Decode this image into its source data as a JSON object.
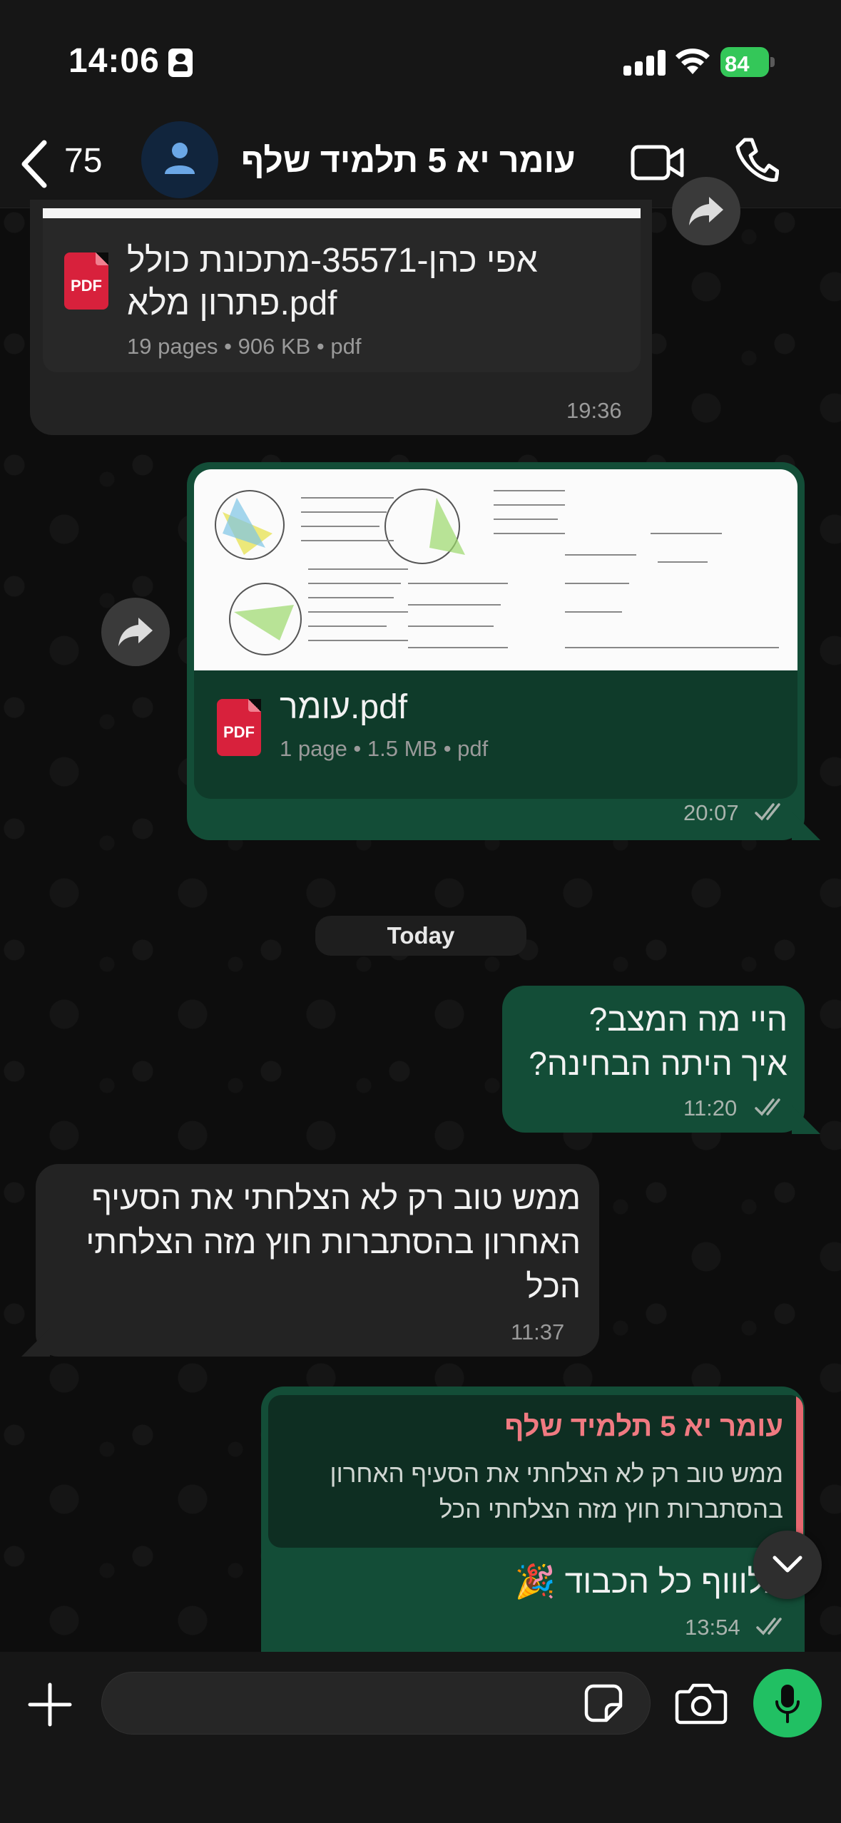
{
  "status_bar": {
    "time": "14:06",
    "battery": "84"
  },
  "header": {
    "back_count": "75",
    "chat_name": "עומר יא 5 תלמיד שלף"
  },
  "messages": [
    {
      "type": "document",
      "direction": "in",
      "file_name_line1": "אפי כהן-35571-מתכונת כולל",
      "file_name_line2": "פתרון מלא.pdf",
      "meta": "19 pages • 906 KB • pdf",
      "time": "19:36"
    },
    {
      "type": "document",
      "direction": "out",
      "file_name": "עומר.pdf",
      "meta": "1 page • 1.5 MB • pdf",
      "time": "20:07"
    },
    {
      "type": "text",
      "direction": "out",
      "line1": "היי מה המצב?",
      "line2": "איך היתה הבחינה?",
      "time": "11:20"
    },
    {
      "type": "text",
      "direction": "in",
      "line1": "ממש טוב רק לא הצלחתי את הסעיף",
      "line2": "האחרון בהסתברות חוץ מזה הצלחתי",
      "line3": "הכל",
      "time": "11:37"
    },
    {
      "type": "reply",
      "direction": "out",
      "quote_name": "עומר יא 5 תלמיד שלף",
      "quote_line1": "ממש טוב רק לא הצלחתי את הסעיף האחרון",
      "quote_line2": "בהסתברות חוץ מזה הצלחתי הכל",
      "text": "אלוווף כל הכבוד 🎉",
      "time": "13:54"
    }
  ],
  "date_divider": "Today",
  "pdf_label": "PDF",
  "colors": {
    "outgoing": "#134d37",
    "incoming": "#232323",
    "accent": "#21c063",
    "reply_name": "#f07a81"
  },
  "icons": [
    "id-card-icon",
    "signal-icon",
    "wifi-icon",
    "battery-icon",
    "back-chevron-icon",
    "person-icon",
    "video-call-icon",
    "phone-icon",
    "forward-icon",
    "read-ticks-icon",
    "chevron-down-icon",
    "plus-icon",
    "sticker-icon",
    "camera-icon",
    "microphone-icon"
  ]
}
